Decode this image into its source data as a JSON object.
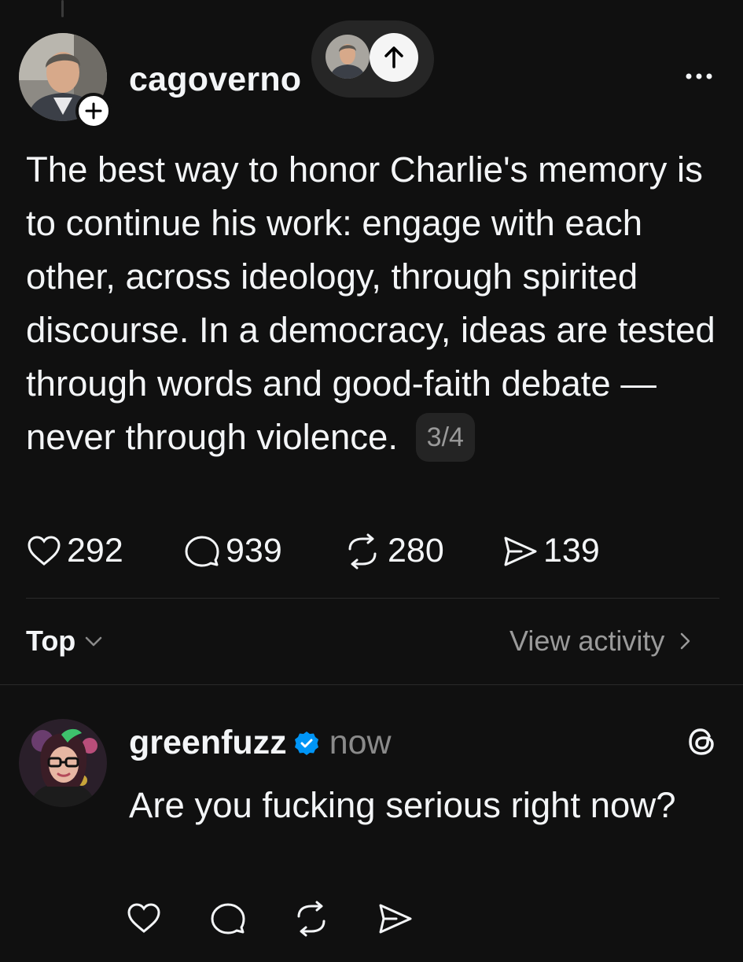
{
  "post": {
    "username": "cagoverno",
    "text": "The best way to honor Charlie's memory is to continue his work: engage with each other, across ideology, through spirited discourse. In a democracy, ideas are tested through words and good-faith debate — never through violence.",
    "page_indicator": "3/4",
    "stats": {
      "likes": "292",
      "replies": "939",
      "reposts": "280",
      "shares": "139"
    }
  },
  "filter": {
    "sort_label": "Top",
    "view_activity_label": "View activity"
  },
  "reply": {
    "username": "greenfuzz",
    "time": "now",
    "verified": true,
    "text": "Are you fucking serious right now?"
  },
  "icons": {
    "follow": "plus-icon",
    "scroll_top": "arrow-up-icon",
    "more": "more-icon",
    "like": "heart-icon",
    "reply": "comment-icon",
    "repost": "repost-icon",
    "share": "send-icon",
    "threads": "threads-logo-icon",
    "verified": "verified-badge-icon"
  },
  "colors": {
    "background": "#101010",
    "text": "#f3f5f7",
    "muted": "#9a9a9a",
    "verified": "#0095f6"
  }
}
